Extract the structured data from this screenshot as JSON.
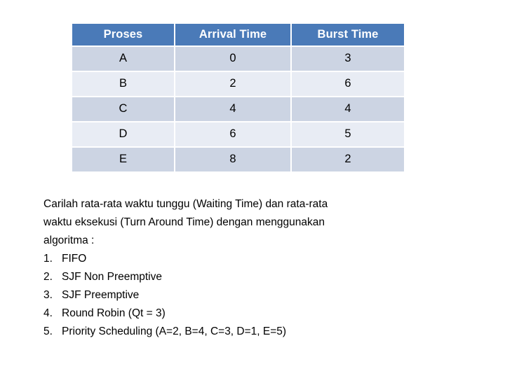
{
  "slide": {
    "background": "#ffffff"
  },
  "table": {
    "header_bg": "#4a7ab8",
    "header_text_color": "#ffffff",
    "row_odd_bg": "#ccd4e3",
    "row_even_bg": "#e8ecf4",
    "columns": [
      "Proses",
      "Arrival Time",
      "Burst Time"
    ],
    "rows": [
      {
        "proses": "A",
        "arrival": "0",
        "burst": "3"
      },
      {
        "proses": "B",
        "arrival": "2",
        "burst": "6"
      },
      {
        "proses": "C",
        "arrival": "4",
        "burst": "4"
      },
      {
        "proses": "D",
        "arrival": "6",
        "burst": "5"
      },
      {
        "proses": "E",
        "arrival": "8",
        "burst": "2"
      }
    ]
  },
  "instructions": {
    "line1": "Carilah rata-rata waktu tunggu (Waiting Time) dan rata-rata",
    "line2": "waktu eksekusi (Turn Around Time) dengan menggunakan",
    "line3": "algoritma :",
    "items": [
      {
        "num": "1.",
        "label": "FIFO"
      },
      {
        "num": "2.",
        "label": "SJF Non Preemptive"
      },
      {
        "num": "3.",
        "label": "SJF Preemptive"
      },
      {
        "num": "4.",
        "label": "Round Robin (Qt = 3)"
      },
      {
        "num": "5.",
        "label": "Priority Scheduling (A=2, B=4, C=3, D=1, E=5)"
      }
    ]
  }
}
